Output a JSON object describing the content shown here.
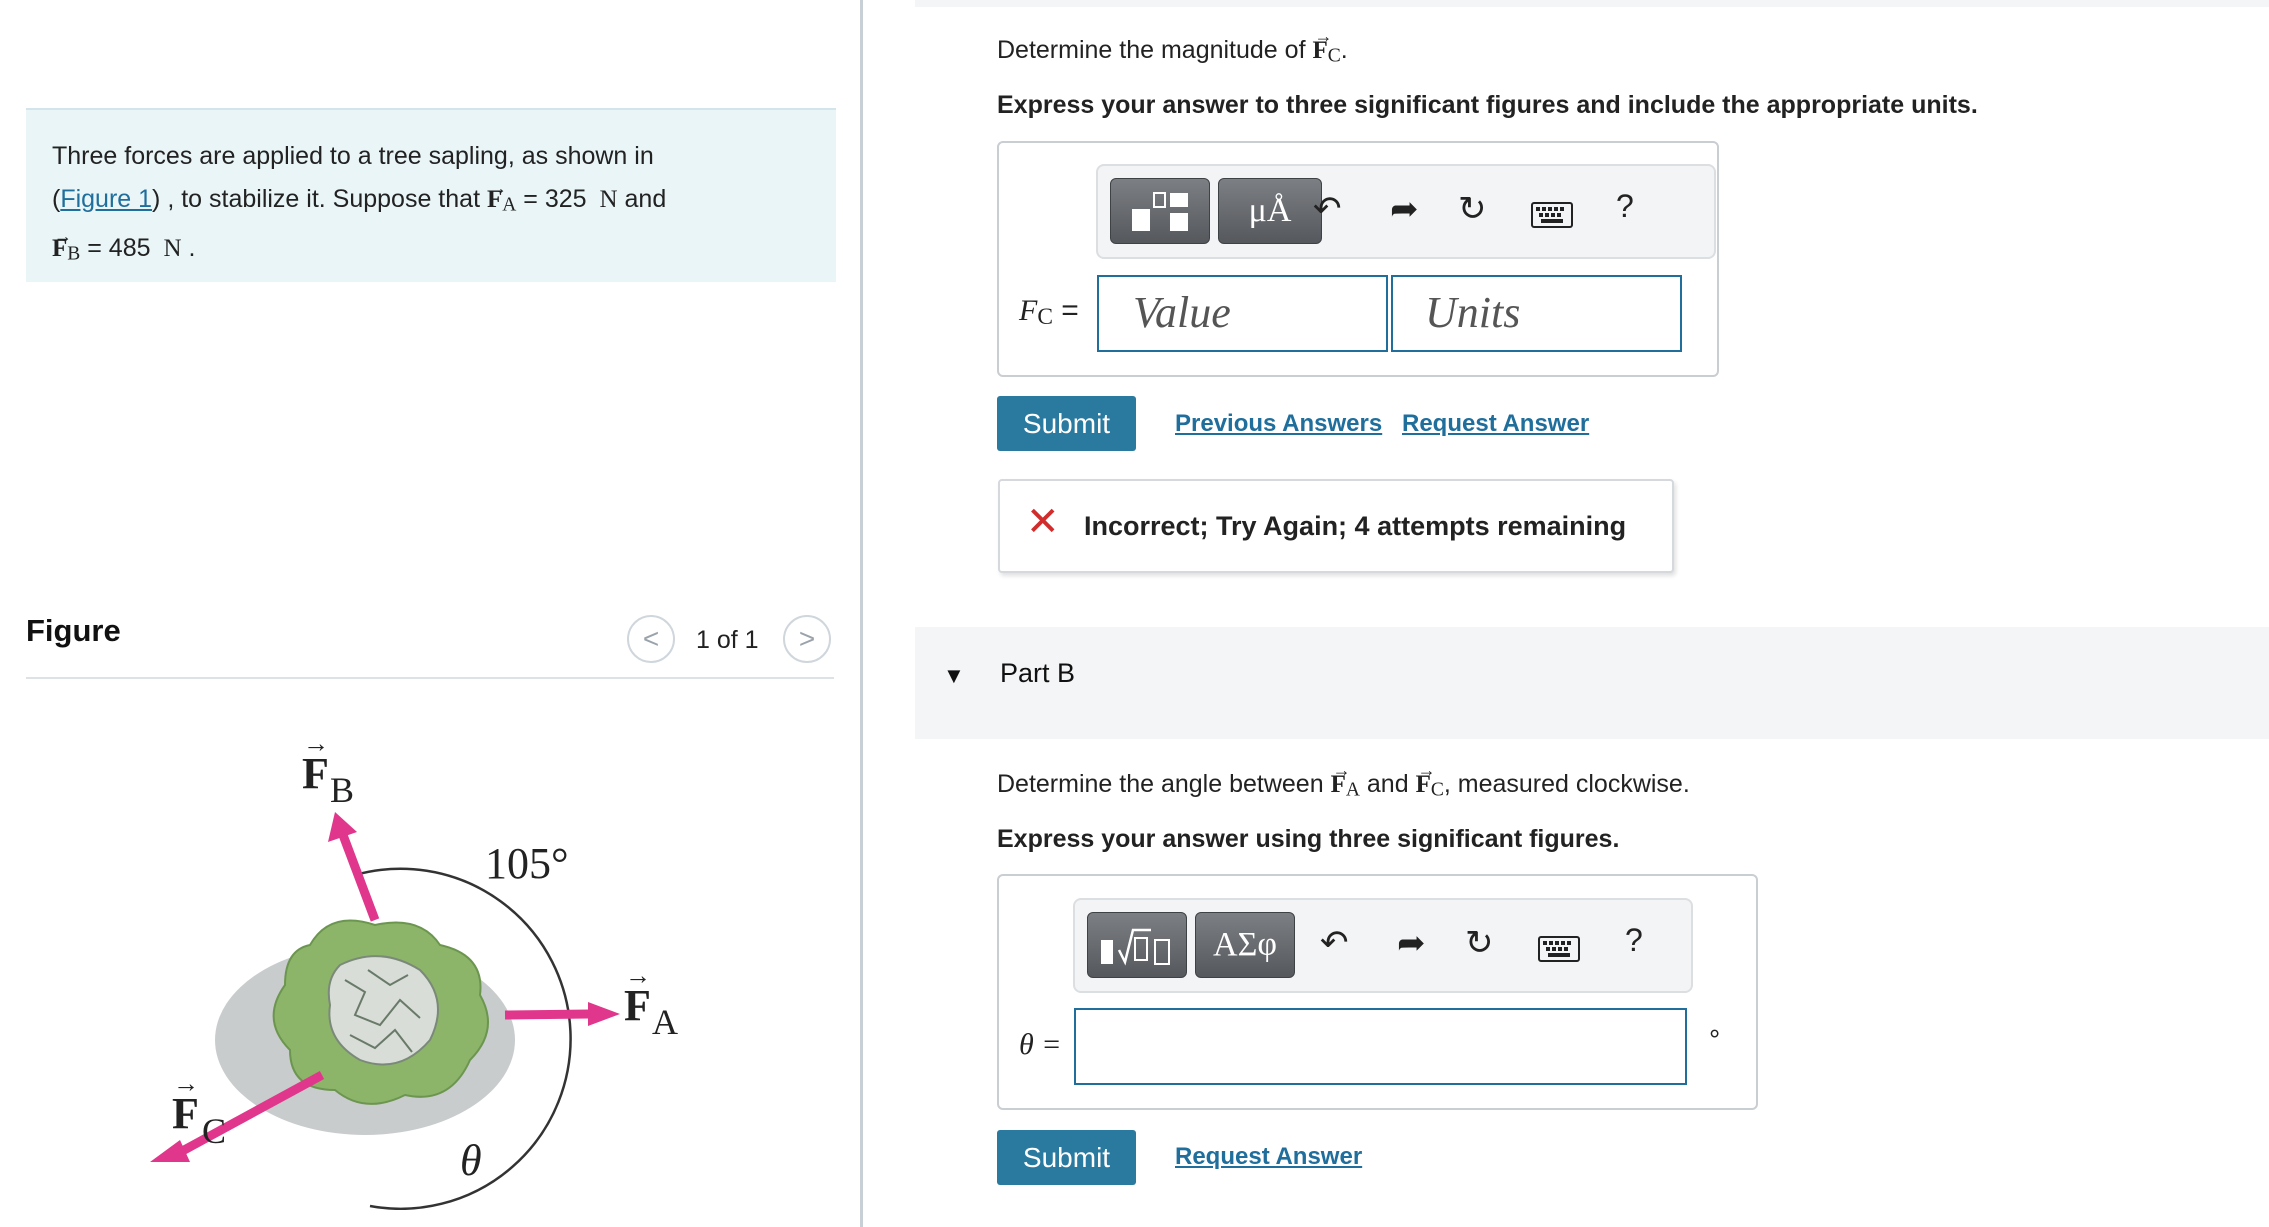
{
  "problem": {
    "intro": "Three forces are applied to a tree sapling, as shown in",
    "figure_link": "Figure 1",
    "after_link": ", to stabilize it. Suppose that",
    "fa_symbol": "F",
    "fa_sub": "A",
    "fa_value": "= 325",
    "fa_unit": "N",
    "and_word": "and",
    "fb_symbol": "F",
    "fb_sub": "B",
    "fb_value": "= 485",
    "fb_unit": "N",
    "end": "."
  },
  "figure": {
    "heading": "Figure",
    "pager": "1 of 1",
    "prev": "<",
    "next": ">",
    "labels": {
      "fb": "F",
      "fb_sub": "B",
      "fa": "F",
      "fa_sub": "A",
      "fc": "F",
      "fc_sub": "C",
      "angle": "105°",
      "theta": "θ"
    },
    "colors": {
      "arrow": "#e0378c",
      "foliage": "#8db56a",
      "ground": "#c9cccd"
    }
  },
  "part_a": {
    "question_pre": "Determine the magnitude of",
    "question_symbol": "F",
    "question_sub": "C",
    "question_post": ".",
    "instruction": "Express your answer to three significant figures and include the appropriate units.",
    "toolbar": {
      "units_button": "μÅ",
      "help": "?"
    },
    "var_label": "F",
    "var_sub": "C",
    "var_eq": "=",
    "value_placeholder": "Value",
    "units_placeholder": "Units",
    "submit": "Submit",
    "previous_answers": "Previous Answers",
    "request_answer": "Request Answer",
    "feedback_icon": "✕",
    "feedback": "Incorrect; Try Again; 4 attempts remaining",
    "feedback_color": "#d22d2d"
  },
  "part_b": {
    "header": "Part B",
    "question_pre": "Determine the angle between",
    "q_sym1": "F",
    "q_sub1": "A",
    "q_and": "and",
    "q_sym2": "F",
    "q_sub2": "C",
    "question_post": ", measured clockwise.",
    "instruction": "Express your answer using three significant figures.",
    "toolbar": {
      "greek_button": "ΑΣφ",
      "help": "?"
    },
    "var_label": "θ =",
    "unit": "°",
    "submit": "Submit",
    "request_answer": "Request Answer"
  },
  "colors": {
    "link": "#1f6e9c",
    "submit_bg": "#2a7aa0",
    "problem_bg": "#e9f5f7"
  }
}
